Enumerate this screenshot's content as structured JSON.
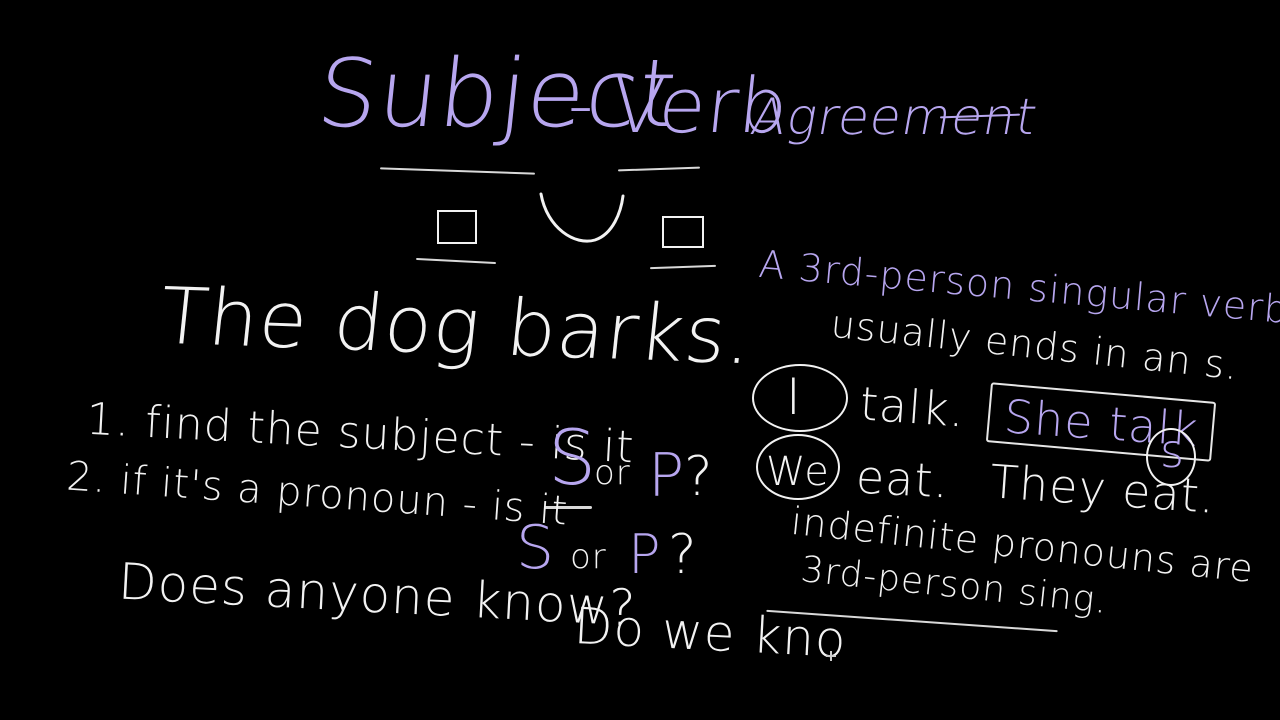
{
  "title": {
    "word1": "Subject",
    "dash": "-",
    "word2": "Verb",
    "word3": "Agreement"
  },
  "example_sentence": "The dog barks.",
  "steps": {
    "step1_prefix": "1. find the subject - is it",
    "step1_s": "S",
    "step1_or": "or",
    "step1_p": "P",
    "step1_q": "?",
    "step2_prefix": "2. if it's a pronoun - is it",
    "step2_s": "S",
    "step2_or": "or",
    "step2_p": "P",
    "step2_q": "?"
  },
  "questions": {
    "q1": "Does anyone know?",
    "q2": "Do we kno"
  },
  "rule": {
    "line1": "A 3rd-person singular verb",
    "line2": "usually ends in an s."
  },
  "examples": {
    "i_pronoun": "I",
    "i_verb": "talk.",
    "she_phrase": "She talk",
    "she_s": "s",
    "we_pronoun": "We",
    "we_verb": "eat.",
    "they_phrase": "They eat."
  },
  "indefinite": {
    "line1": "indefinite pronouns are",
    "line2": "3rd-person sing."
  },
  "colors": {
    "background": "#000000",
    "chalk_white": "#f2f2f2",
    "chalk_purple": "#b7a6ef"
  }
}
